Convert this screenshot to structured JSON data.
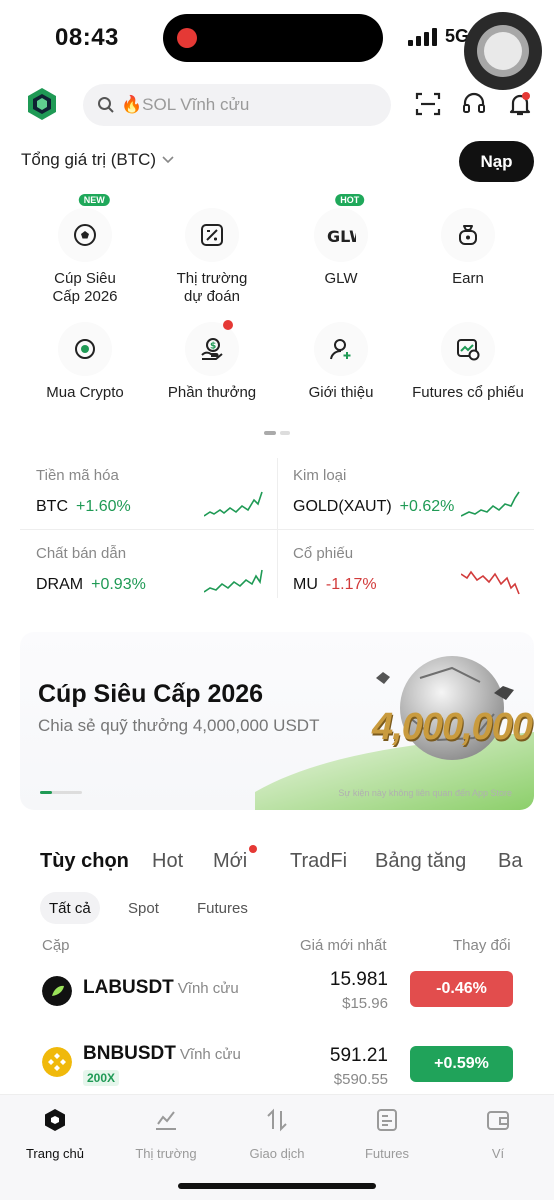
{
  "status_bar": {
    "time": "08:43",
    "network": "5G"
  },
  "header": {
    "search_placeholder": "🔥SOL Vĩnh cửu",
    "total_value_label": "Tổng giá trị (BTC)",
    "deposit_label": "Nạp"
  },
  "quick_actions": [
    {
      "label": "Cúp Siêu\nCấp 2026",
      "badge": "NEW",
      "icon": "soccer-ball-icon"
    },
    {
      "label": "Thị trường\ndự đoán",
      "icon": "prediction-icon"
    },
    {
      "label": "GLW",
      "badge": "HOT",
      "icon": "glw-logo-icon"
    },
    {
      "label": "Earn",
      "icon": "money-bag-icon"
    },
    {
      "label": "Mua Crypto",
      "icon": "buy-crypto-icon"
    },
    {
      "label": "Phần thưởng",
      "icon": "reward-hand-icon",
      "dot": true
    },
    {
      "label": "Giới thiệu",
      "icon": "referral-user-icon"
    },
    {
      "label": "Futures cổ phiếu",
      "icon": "stock-futures-icon"
    }
  ],
  "market_tiles": [
    {
      "category": "Tiền mã hóa",
      "symbol": "BTC",
      "change": "+1.60%",
      "trend": "up"
    },
    {
      "category": "Kim loại",
      "symbol": "GOLD(XAUT)",
      "change": "+0.62%",
      "trend": "up"
    },
    {
      "category": "Chất bán dẫn",
      "symbol": "DRAM",
      "change": "+0.93%",
      "trend": "up"
    },
    {
      "category": "Cổ phiếu",
      "symbol": "MU",
      "change": "-1.17%",
      "trend": "down"
    }
  ],
  "banner": {
    "title": "Cúp Siêu Cấp 2026",
    "subtitle": "Chia sẻ quỹ thưởng 4,000,000 USDT",
    "prize_text": "4,000,000",
    "disclaimer": "Sự kiện này không liên quan đến App Store"
  },
  "tabs": [
    "Tùy chọn",
    "Hot",
    "Mới",
    "TradFi",
    "Bảng tăng",
    "Ba"
  ],
  "subtabs": [
    "Tất cả",
    "Spot",
    "Futures"
  ],
  "columns": {
    "pair": "Cặp",
    "last_price": "Giá mới nhất",
    "change": "Thay đổi"
  },
  "rows": [
    {
      "base": "LABUSDT",
      "type": "Vĩnh cửu",
      "price": "15.981",
      "fiat": "$15.96",
      "change": "-0.46%",
      "leverage": ""
    },
    {
      "base": "BNBUSDT",
      "type": "Vĩnh cửu",
      "price": "591.21",
      "fiat": "$590.55",
      "change": "+0.59%",
      "leverage": "200X"
    }
  ],
  "bottom_nav": [
    "Trang chủ",
    "Thị trường",
    "Giao dịch",
    "Futures",
    "Ví"
  ],
  "colors": {
    "up": "#1f9a55",
    "down": "#d23b3b",
    "accent": "#111111"
  }
}
